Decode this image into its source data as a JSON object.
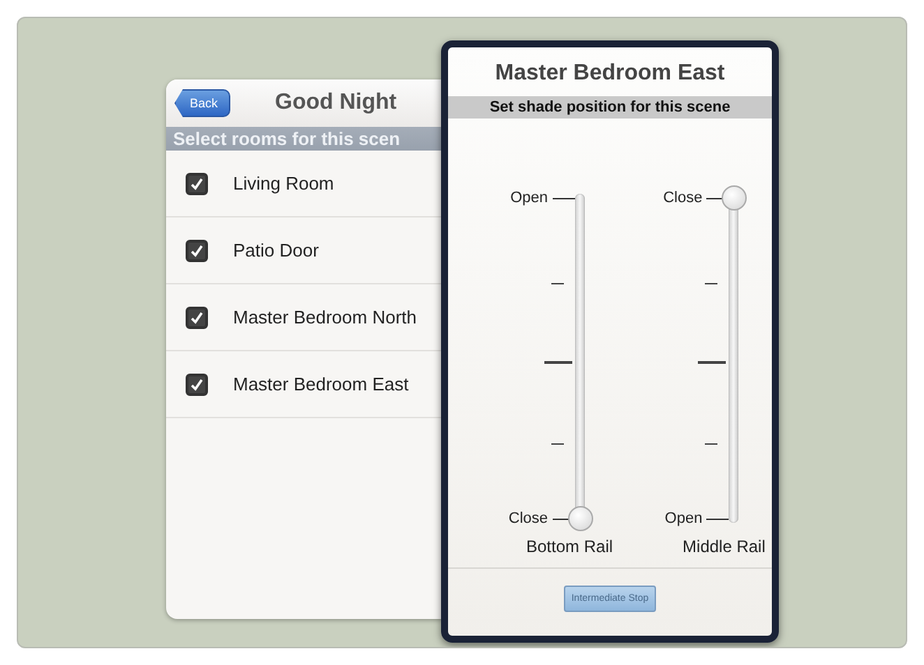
{
  "scene": {
    "back_button": "Back",
    "title": "Good Night",
    "rooms_header": "Select rooms for this scen",
    "rooms": [
      {
        "label": "Living Room",
        "checked": true
      },
      {
        "label": "Patio Door",
        "checked": true
      },
      {
        "label": "Master Bedroom North",
        "checked": true
      },
      {
        "label": "Master Bedroom East",
        "checked": true
      }
    ]
  },
  "dialog": {
    "title": "Master Bedroom East",
    "subtitle": "Set shade position for this scene",
    "sliders": [
      {
        "name": "Bottom Rail",
        "top_label": "Open",
        "bottom_label": "Close",
        "level": 0
      },
      {
        "name": "Middle Rail",
        "top_label": "Close",
        "bottom_label": "Open",
        "level": 1
      }
    ],
    "button": "Intermediate Stop"
  }
}
